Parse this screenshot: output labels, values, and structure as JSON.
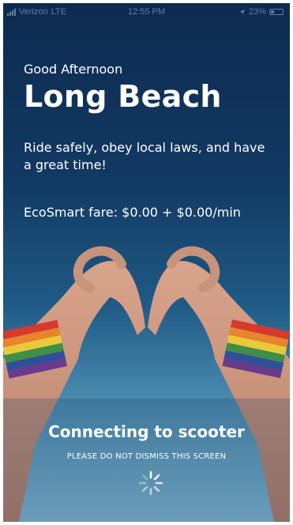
{
  "status_bar": {
    "carrier": "Verizon",
    "network": "LTE",
    "time": "12:55 PM",
    "battery": "23%",
    "icons": [
      "signal-icon",
      "location-arrow-icon",
      "battery-icon"
    ]
  },
  "main": {
    "greeting": "Good Afternoon",
    "city": "Long Beach",
    "message": "Ride safely, obey local laws, and have a great time!",
    "fare": "EcoSmart fare: $0.00 + $0.00/min",
    "connecting": "Connecting to scooter",
    "notice": "PLEASE DO NOT DISMISS THIS SCREEN",
    "spinner": "spinner-icon"
  },
  "colors": {
    "background_top": "#0d2a4f",
    "background_bottom": "#86bdd6",
    "text": "#ffffff",
    "status_text": "#5f7fa3"
  }
}
